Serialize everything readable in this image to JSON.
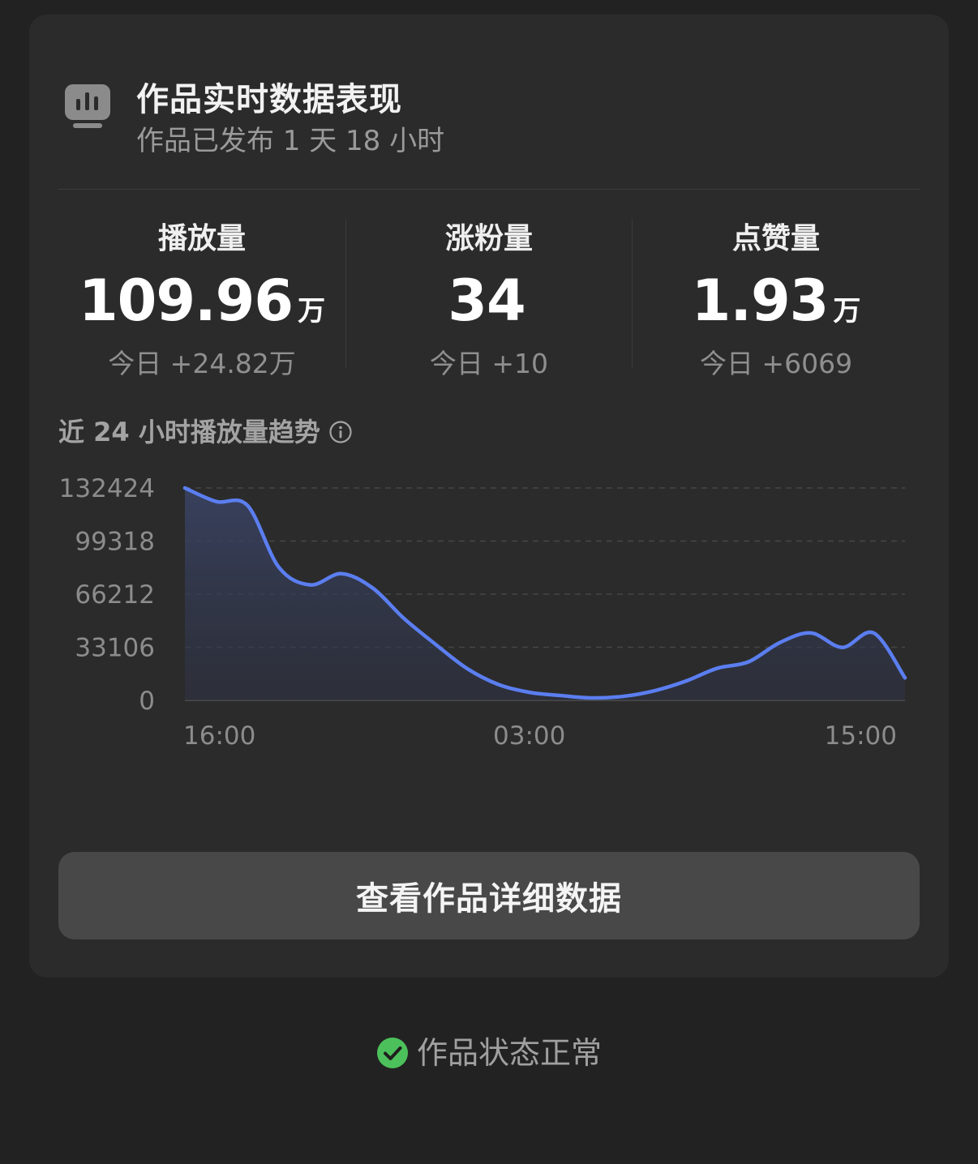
{
  "header": {
    "title": "作品实时数据表现",
    "subtitle": "作品已发布 1 天 18 小时",
    "icon": "bar-chart-monitor-icon"
  },
  "stats": [
    {
      "label": "播放量",
      "value": "109.96",
      "unit": "万",
      "delta": "今日 +24.82万"
    },
    {
      "label": "涨粉量",
      "value": "34",
      "unit": "",
      "delta": "今日 +10"
    },
    {
      "label": "点赞量",
      "value": "1.93",
      "unit": "万",
      "delta": "今日 +6069"
    }
  ],
  "trend": {
    "title": "近 24 小时播放量趋势",
    "info_icon": "info-circle-icon"
  },
  "chart_data": {
    "type": "area",
    "x_labels": [
      "16:00",
      "03:00",
      "15:00"
    ],
    "x": [
      "16:00",
      "17:00",
      "18:00",
      "19:00",
      "20:00",
      "21:00",
      "22:00",
      "23:00",
      "00:00",
      "01:00",
      "02:00",
      "03:00",
      "04:00",
      "05:00",
      "06:00",
      "07:00",
      "08:00",
      "09:00",
      "10:00",
      "11:00",
      "12:00",
      "13:00",
      "14:00",
      "15:00"
    ],
    "series": [
      {
        "values": [
          132424,
          124000,
          121500,
          83000,
          72000,
          79000,
          70000,
          51000,
          35000,
          20000,
          10000,
          5000,
          3000,
          1500,
          2500,
          6000,
          12000,
          20000,
          24000,
          36000,
          42000,
          33000,
          42000,
          14000
        ]
      }
    ],
    "y_ticks": [
      0,
      33106,
      66212,
      99318,
      132424
    ],
    "ylim": [
      0,
      132424
    ],
    "grid": true,
    "line_color": "#5b7ef0",
    "fill_color": "#3a4466"
  },
  "action": {
    "label": "查看作品详细数据"
  },
  "status": {
    "text": "作品状态正常",
    "icon": "check-circle-icon",
    "icon_color": "#4cc15b"
  }
}
